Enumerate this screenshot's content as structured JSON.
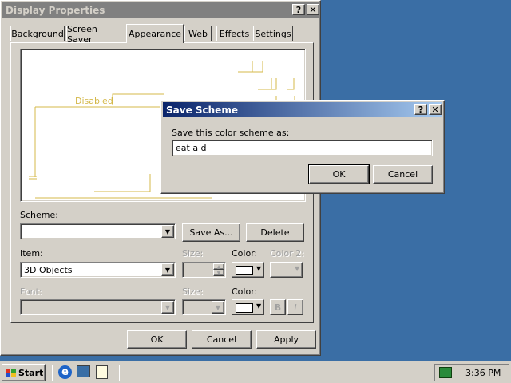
{
  "display_properties": {
    "title": "Display Properties",
    "help_label": "?",
    "close_label": "✕",
    "tabs": [
      {
        "label": "Background"
      },
      {
        "label": "Screen Saver"
      },
      {
        "label": "Appearance",
        "active": true
      },
      {
        "label": "Web"
      },
      {
        "label": "Effects"
      },
      {
        "label": "Settings"
      }
    ],
    "preview": {
      "disabled_label": "Disabled"
    },
    "scheme_label": "Scheme:",
    "scheme_value": "",
    "save_as_label": "Save As...",
    "delete_label": "Delete",
    "item_label": "Item:",
    "item_value": "3D Objects",
    "size_label": "Size:",
    "color_label": "Color:",
    "color2_label": "Color 2:",
    "font_label": "Font:",
    "font_size_label": "Size:",
    "font_color_label": "Color:",
    "bold_label": "B",
    "italic_label": "I",
    "ok_label": "OK",
    "cancel_label": "Cancel",
    "apply_label": "Apply"
  },
  "save_scheme": {
    "title": "Save Scheme",
    "help_label": "?",
    "close_label": "✕",
    "prompt": "Save this color scheme as:",
    "input_value": "eat a d",
    "ok_label": "OK",
    "cancel_label": "Cancel"
  },
  "taskbar": {
    "start_label": "Start",
    "clock": "3:36 PM"
  },
  "colors": {
    "title_active_start": "#0a246a",
    "title_active_end": "#a6caf0",
    "title_inactive": "#808080",
    "desktop": "#3a6ea5",
    "face": "#d4d0c8"
  }
}
